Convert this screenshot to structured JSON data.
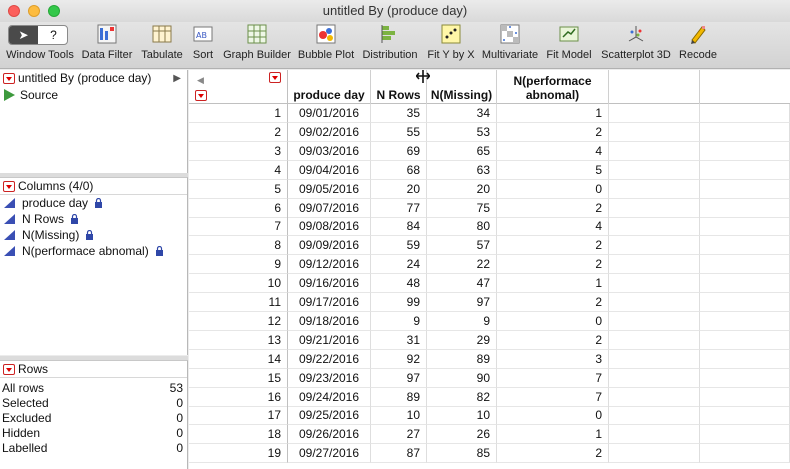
{
  "window": {
    "title": "untitled By (produce day)"
  },
  "toolbar": {
    "seg_help": "?",
    "items": [
      {
        "label": "Window Tools"
      },
      {
        "label": "Data Filter"
      },
      {
        "label": "Tabulate"
      },
      {
        "label": "Sort"
      },
      {
        "label": "Graph Builder"
      },
      {
        "label": "Bubble Plot"
      },
      {
        "label": "Distribution"
      },
      {
        "label": "Fit Y by X"
      },
      {
        "label": "Multivariate"
      },
      {
        "label": "Fit Model"
      },
      {
        "label": "Scatterplot 3D"
      },
      {
        "label": "Recode"
      }
    ]
  },
  "table_panel": {
    "title": "untitled By (produce day)",
    "source": "Source"
  },
  "columns_panel": {
    "title": "Columns (4/0)",
    "items": [
      "produce day",
      "N Rows",
      "N(Missing)",
      "N(performace abnomal)"
    ]
  },
  "rows_panel": {
    "title": "Rows",
    "stats": [
      {
        "label": "All rows",
        "value": "53"
      },
      {
        "label": "Selected",
        "value": "0"
      },
      {
        "label": "Excluded",
        "value": "0"
      },
      {
        "label": "Hidden",
        "value": "0"
      },
      {
        "label": "Labelled",
        "value": "0"
      }
    ]
  },
  "table": {
    "headers": [
      "produce day",
      "N Rows",
      "N(Missing)",
      "N(performace\nabnomal)"
    ],
    "rows": [
      [
        "1",
        "09/01/2016",
        "35",
        "34",
        "1"
      ],
      [
        "2",
        "09/02/2016",
        "55",
        "53",
        "2"
      ],
      [
        "3",
        "09/03/2016",
        "69",
        "65",
        "4"
      ],
      [
        "4",
        "09/04/2016",
        "68",
        "63",
        "5"
      ],
      [
        "5",
        "09/05/2016",
        "20",
        "20",
        "0"
      ],
      [
        "6",
        "09/07/2016",
        "77",
        "75",
        "2"
      ],
      [
        "7",
        "09/08/2016",
        "84",
        "80",
        "4"
      ],
      [
        "8",
        "09/09/2016",
        "59",
        "57",
        "2"
      ],
      [
        "9",
        "09/12/2016",
        "24",
        "22",
        "2"
      ],
      [
        "10",
        "09/16/2016",
        "48",
        "47",
        "1"
      ],
      [
        "11",
        "09/17/2016",
        "99",
        "97",
        "2"
      ],
      [
        "12",
        "09/18/2016",
        "9",
        "9",
        "0"
      ],
      [
        "13",
        "09/21/2016",
        "31",
        "29",
        "2"
      ],
      [
        "14",
        "09/22/2016",
        "92",
        "89",
        "3"
      ],
      [
        "15",
        "09/23/2016",
        "97",
        "90",
        "7"
      ],
      [
        "16",
        "09/24/2016",
        "89",
        "82",
        "7"
      ],
      [
        "17",
        "09/25/2016",
        "10",
        "10",
        "0"
      ],
      [
        "18",
        "09/26/2016",
        "27",
        "26",
        "1"
      ],
      [
        "19",
        "09/27/2016",
        "87",
        "85",
        "2"
      ]
    ]
  }
}
